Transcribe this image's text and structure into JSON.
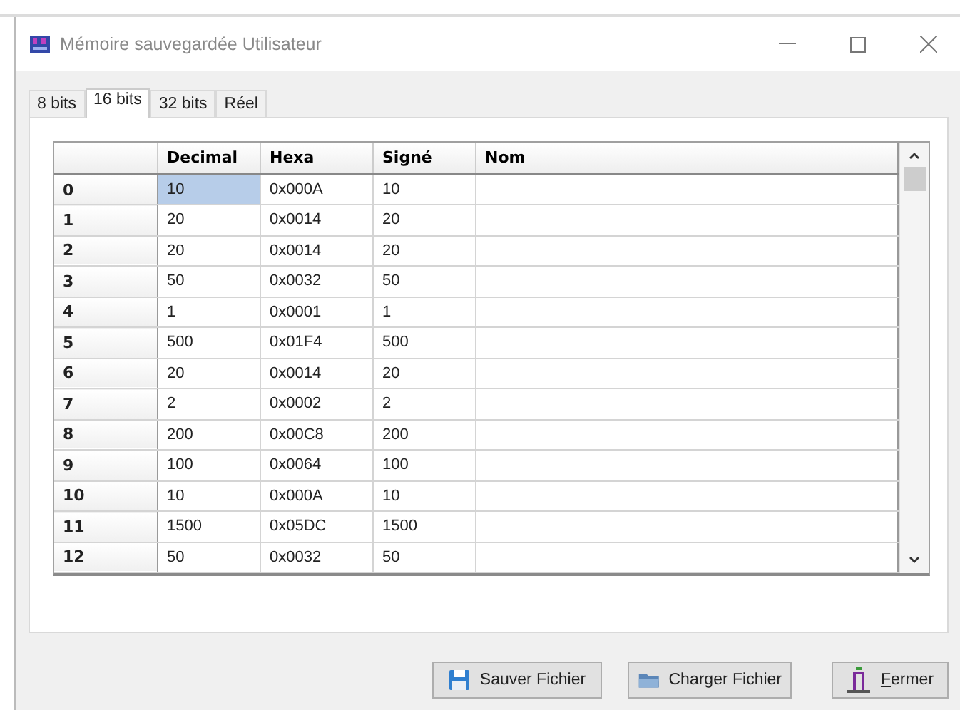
{
  "window": {
    "title": "Mémoire sauvegardée Utilisateur"
  },
  "tabs": [
    {
      "label": "8 bits",
      "selected": false
    },
    {
      "label": "16 bits",
      "selected": true
    },
    {
      "label": "32 bits",
      "selected": false
    },
    {
      "label": "Réel",
      "selected": false
    }
  ],
  "table": {
    "columns": [
      "Decimal",
      "Hexa",
      "Signé",
      "Nom"
    ],
    "rows": [
      {
        "label": "0",
        "cells": [
          {
            "text": "10",
            "selected": true
          },
          {
            "text": "0x000A",
            "selected": false
          },
          {
            "text": "10",
            "selected": false
          }
        ]
      },
      {
        "label": "1",
        "cells": [
          {
            "text": "20",
            "selected": false
          },
          {
            "text": "0x0014",
            "selected": false
          },
          {
            "text": "20",
            "selected": false
          }
        ]
      },
      {
        "label": "2",
        "cells": [
          {
            "text": "20",
            "selected": false
          },
          {
            "text": "0x0014",
            "selected": false
          },
          {
            "text": "20",
            "selected": false
          }
        ]
      },
      {
        "label": "3",
        "cells": [
          {
            "text": "50",
            "selected": false
          },
          {
            "text": "0x0032",
            "selected": false
          },
          {
            "text": "50",
            "selected": false
          }
        ]
      },
      {
        "label": "4",
        "cells": [
          {
            "text": "1",
            "selected": false
          },
          {
            "text": "0x0001",
            "selected": false
          },
          {
            "text": "1",
            "selected": false
          }
        ]
      },
      {
        "label": "5",
        "cells": [
          {
            "text": "500",
            "selected": false
          },
          {
            "text": "0x01F4",
            "selected": false
          },
          {
            "text": "500",
            "selected": false
          }
        ]
      },
      {
        "label": "6",
        "cells": [
          {
            "text": "20",
            "selected": false
          },
          {
            "text": "0x0014",
            "selected": false
          },
          {
            "text": "20",
            "selected": false
          }
        ]
      },
      {
        "label": "7",
        "cells": [
          {
            "text": "2",
            "selected": false
          },
          {
            "text": "0x0002",
            "selected": false
          },
          {
            "text": "2",
            "selected": false
          }
        ]
      },
      {
        "label": "8",
        "cells": [
          {
            "text": "200",
            "selected": false
          },
          {
            "text": "0x00C8",
            "selected": false
          },
          {
            "text": "200",
            "selected": false
          }
        ]
      },
      {
        "label": "9",
        "cells": [
          {
            "text": "100",
            "selected": false
          },
          {
            "text": "0x0064",
            "selected": false
          },
          {
            "text": "100",
            "selected": false
          }
        ]
      },
      {
        "label": "10",
        "cells": [
          {
            "text": "10",
            "selected": false
          },
          {
            "text": "0x000A",
            "selected": false
          },
          {
            "text": "10",
            "selected": false
          }
        ]
      },
      {
        "label": "11",
        "cells": [
          {
            "text": "1500",
            "selected": false
          },
          {
            "text": "0x05DC",
            "selected": false
          },
          {
            "text": "1500",
            "selected": false
          }
        ]
      },
      {
        "label": "12",
        "cells": [
          {
            "text": "50",
            "selected": false
          },
          {
            "text": "0x0032",
            "selected": false
          },
          {
            "text": "50",
            "selected": false
          }
        ]
      }
    ]
  },
  "buttons": [
    {
      "kind": "save",
      "label": "Sauver Fichier",
      "mnemonic": false
    },
    {
      "kind": "load",
      "label": "Charger Fichier",
      "mnemonic": false
    },
    {
      "kind": "close",
      "label": "Fermer",
      "mnemonic": true
    }
  ]
}
